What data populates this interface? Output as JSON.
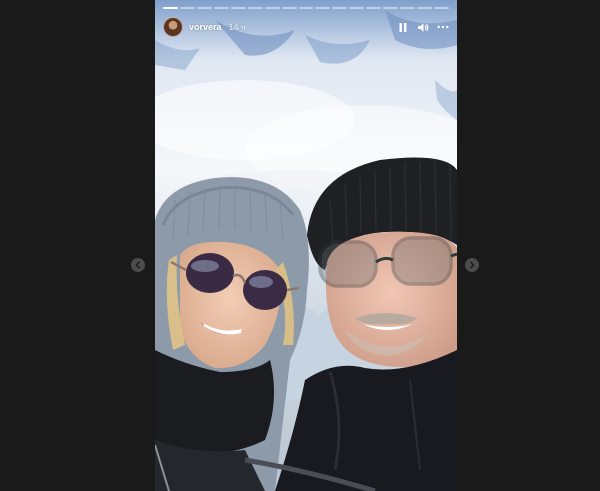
{
  "story": {
    "username": "vorvera",
    "time_ago": "14 ч",
    "segments_total": 17,
    "segments_done": 1,
    "photo_description": "selfie-two-people-snowy-mountain"
  },
  "controls": {
    "pause_icon": "pause-icon",
    "sound_icon": "volume-icon",
    "more_icon": "more-icon"
  },
  "nav": {
    "prev_icon": "chevron-left-icon",
    "next_icon": "chevron-right-icon"
  },
  "colors": {
    "backdrop": "#1a1a1a",
    "progress_done": "#ffffff"
  }
}
